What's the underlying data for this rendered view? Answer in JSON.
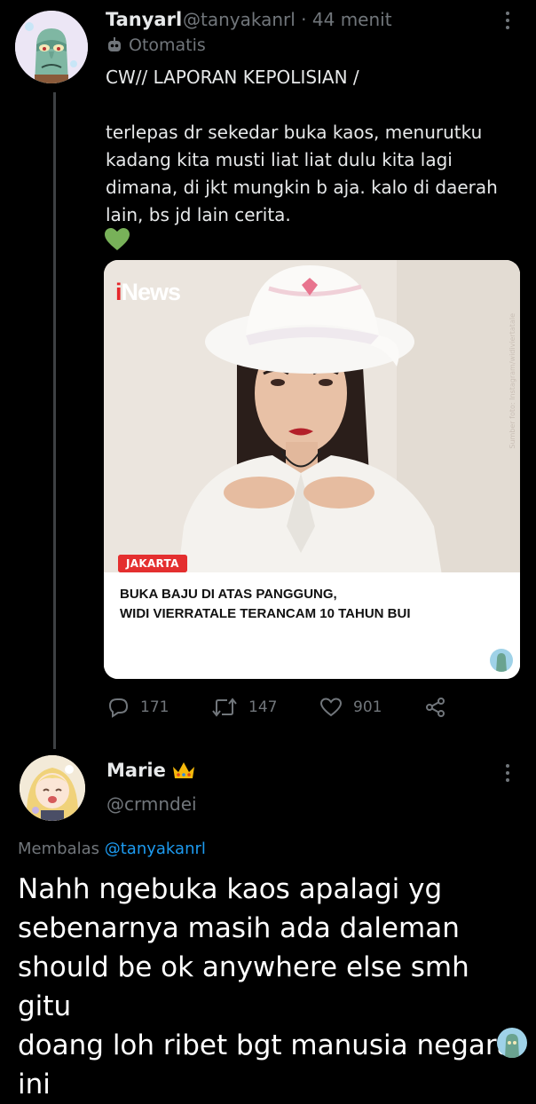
{
  "tweet": {
    "author_name": "Tanyarl",
    "handle": "@tanyakanrl",
    "separator": "·",
    "time": "44 menit",
    "automated_label": "Otomatis",
    "text_line1": "CW// LAPORAN KEPOLISIAN /",
    "text_body": "terlepas dr sekedar buka kaos, menurutku\nkadang kita musti liat liat dulu kita lagi\ndimana, di jkt mungkin b aja. kalo di daerah\nlain, bs jd lain cerita.",
    "emoji": "green-heart",
    "media": {
      "logo_i": "i",
      "logo_rest": "News",
      "credit": "Sumber foto: Instagram/widiviertatale",
      "location_tag": "JAKARTA",
      "headline": "BUKA BAJU DI ATAS PANGGUNG,\nWIDI VIERRATALE TERANCAM 10 TAHUN BUI"
    },
    "actions": {
      "replies": "171",
      "retweets": "147",
      "likes": "901"
    }
  },
  "reply": {
    "author_name": "Marie",
    "handle": "@crmndei",
    "replying_prefix": "Membalas",
    "replying_to": "@tanyakanrl",
    "text": "Nahh ngebuka kaos apalagi yg\nsebenarnya masih ada daleman\nshould be ok anywhere else smh gitu\ndoang loh ribet bgt manusia negara\nini"
  },
  "colors": {
    "background": "#000000",
    "text": "#e7e9ea",
    "muted": "#71767b",
    "link": "#1d9bf0",
    "heart_emoji": "#78b159"
  }
}
